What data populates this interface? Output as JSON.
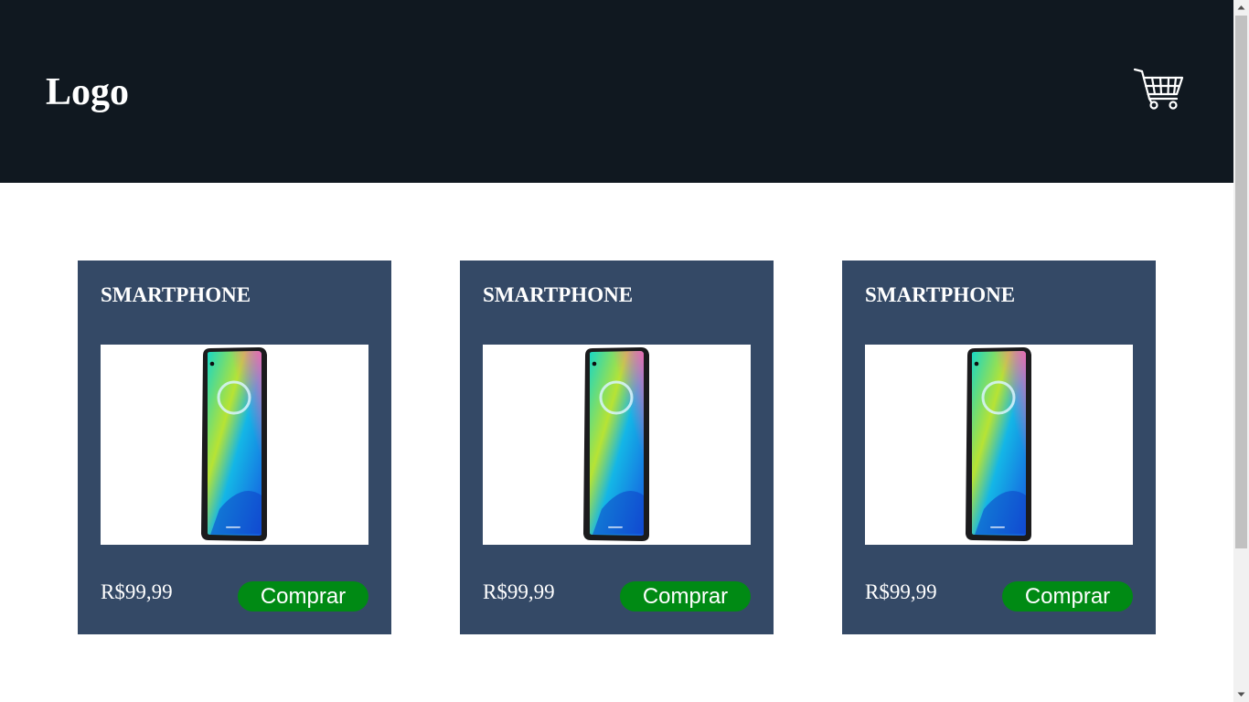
{
  "header": {
    "logo_text": "Logo",
    "cart_icon": "shopping-cart-icon",
    "background": "#101820"
  },
  "products": [
    {
      "title": "SMARTPHONE",
      "image_icon": "smartphone-image",
      "price": "R$99,99",
      "button_label": "Comprar"
    },
    {
      "title": "SMARTPHONE",
      "image_icon": "smartphone-image",
      "price": "R$99,99",
      "button_label": "Comprar"
    },
    {
      "title": "SMARTPHONE",
      "image_icon": "smartphone-image",
      "price": "R$99,99",
      "button_label": "Comprar"
    }
  ],
  "colors": {
    "card_background": "#344966",
    "button_background": "#008a14",
    "text": "#ffffff"
  }
}
